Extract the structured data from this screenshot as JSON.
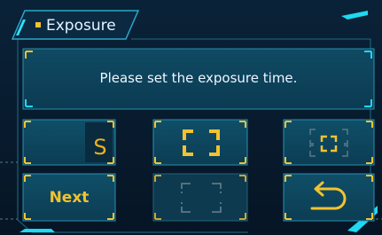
{
  "dialog": {
    "title": "Exposure",
    "message": "Please set the exposure time."
  },
  "buttons": {
    "shutter_mode_label": "S",
    "next_label": "Next"
  },
  "icons": {
    "full_frame": "focus-frame-icon",
    "multi_area": "multi-area-focus-icon",
    "spot": "spot-area-icon",
    "back": "return-arrow-icon"
  },
  "colors": {
    "background": "#071a2e",
    "panel": "#0d3a52",
    "accent_cyan": "#1fd8f2",
    "accent_yellow": "#f2c230",
    "disabled": "#5d7883"
  },
  "state": {
    "selected_button": "full-frame",
    "disabled_buttons": [
      "multi-area",
      "spot"
    ]
  }
}
